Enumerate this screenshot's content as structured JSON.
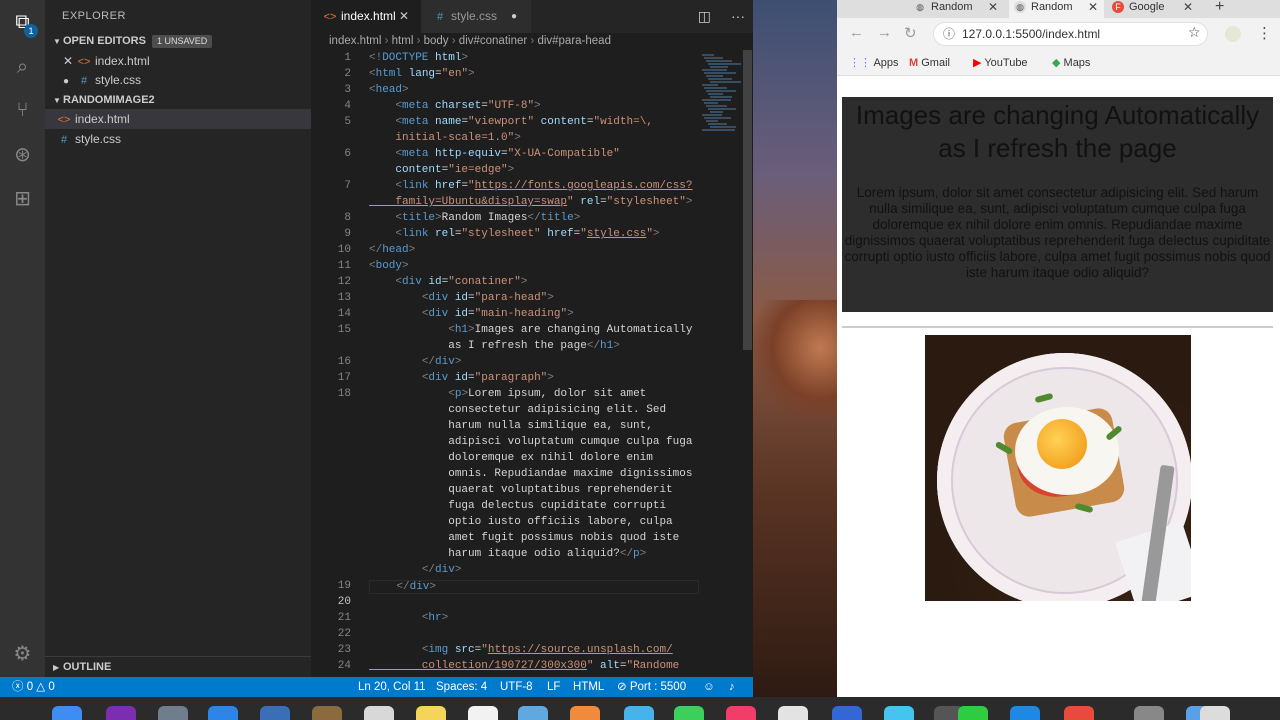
{
  "explorer": {
    "title": "EXPLORER",
    "open_editors_label": "OPEN EDITORS",
    "unsaved_badge": "1 UNSAVED",
    "open_editors": [
      {
        "name": "index.html",
        "type": "html"
      },
      {
        "name": "style.css",
        "type": "css"
      }
    ],
    "project_label": "RANDOMIMAGE2",
    "project_files": [
      {
        "name": "index.html",
        "type": "html"
      },
      {
        "name": "style.css",
        "type": "css"
      }
    ],
    "outline_label": "OUTLINE",
    "activity_badge": "1"
  },
  "tabs": [
    {
      "label": "index.html",
      "icon": "<>",
      "active": true
    },
    {
      "label": "style.css",
      "icon": "#",
      "active": false
    }
  ],
  "breadcrumb": [
    "index.html",
    "html",
    "body",
    "div#conatiner",
    "div#para-head"
  ],
  "line_numbers": [
    "1",
    "2",
    "3",
    "4",
    "5",
    "",
    "6",
    "",
    "7",
    "",
    "8",
    "9",
    "10",
    "11",
    "12",
    "13",
    "14",
    "15",
    "",
    "16",
    "17",
    "18",
    "",
    "",
    "",
    "",
    "",
    "",
    "",
    "",
    "",
    "",
    "",
    "19",
    "20",
    "21",
    "22",
    "23",
    "24",
    ""
  ],
  "code_lines": [
    [
      {
        "c": "tg",
        "t": "<!"
      },
      {
        "c": "tn",
        "t": "DOCTYPE"
      },
      {
        "c": "at",
        "t": " html"
      },
      {
        "c": "tg",
        "t": ">"
      }
    ],
    [
      {
        "c": "tg",
        "t": "<"
      },
      {
        "c": "tn",
        "t": "html"
      },
      {
        "c": "at",
        "t": " lang"
      },
      {
        "c": "tx",
        "t": "="
      },
      {
        "c": "sv",
        "t": "\"en\""
      },
      {
        "c": "tg",
        "t": ">"
      }
    ],
    [
      {
        "c": "tg",
        "t": "<"
      },
      {
        "c": "tn",
        "t": "head"
      },
      {
        "c": "tg",
        "t": ">"
      }
    ],
    [
      {
        "c": "tx",
        "t": "    "
      },
      {
        "c": "tg",
        "t": "<"
      },
      {
        "c": "tn",
        "t": "meta"
      },
      {
        "c": "at",
        "t": " charset"
      },
      {
        "c": "tx",
        "t": "="
      },
      {
        "c": "sv",
        "t": "\"UTF-8\""
      },
      {
        "c": "tg",
        "t": ">"
      }
    ],
    [
      {
        "c": "tx",
        "t": "    "
      },
      {
        "c": "tg",
        "t": "<"
      },
      {
        "c": "tn",
        "t": "meta"
      },
      {
        "c": "at",
        "t": " name"
      },
      {
        "c": "tx",
        "t": "="
      },
      {
        "c": "sv",
        "t": "\"viewport\""
      },
      {
        "c": "at",
        "t": " content"
      },
      {
        "c": "tx",
        "t": "="
      },
      {
        "c": "sv",
        "t": "\"width=\\,"
      }
    ],
    [
      {
        "c": "sv",
        "t": "    initial-scale=1.0\""
      },
      {
        "c": "tg",
        "t": ">"
      }
    ],
    [
      {
        "c": "tx",
        "t": "    "
      },
      {
        "c": "tg",
        "t": "<"
      },
      {
        "c": "tn",
        "t": "meta"
      },
      {
        "c": "at",
        "t": " http-equiv"
      },
      {
        "c": "tx",
        "t": "="
      },
      {
        "c": "sv",
        "t": "\"X-UA-Compatible\""
      }
    ],
    [
      {
        "c": "at",
        "t": "    content"
      },
      {
        "c": "tx",
        "t": "="
      },
      {
        "c": "sv",
        "t": "\"ie=edge\""
      },
      {
        "c": "tg",
        "t": ">"
      }
    ],
    [
      {
        "c": "tx",
        "t": "    "
      },
      {
        "c": "tg",
        "t": "<"
      },
      {
        "c": "tn",
        "t": "link"
      },
      {
        "c": "at",
        "t": " href"
      },
      {
        "c": "tx",
        "t": "="
      },
      {
        "c": "sv",
        "t": "\""
      },
      {
        "c": "sv u",
        "t": "https://fonts.googleapis.com/css?"
      }
    ],
    [
      {
        "c": "sv u",
        "t": "    family=Ubuntu&display=swap"
      },
      {
        "c": "sv",
        "t": "\""
      },
      {
        "c": "at",
        "t": " rel"
      },
      {
        "c": "tx",
        "t": "="
      },
      {
        "c": "sv",
        "t": "\"stylesheet\""
      },
      {
        "c": "tg",
        "t": ">"
      }
    ],
    [
      {
        "c": "tx",
        "t": "    "
      },
      {
        "c": "tg",
        "t": "<"
      },
      {
        "c": "tn",
        "t": "title"
      },
      {
        "c": "tg",
        "t": ">"
      },
      {
        "c": "tx",
        "t": "Random Images"
      },
      {
        "c": "tg",
        "t": "</"
      },
      {
        "c": "tn",
        "t": "title"
      },
      {
        "c": "tg",
        "t": ">"
      }
    ],
    [
      {
        "c": "tx",
        "t": "    "
      },
      {
        "c": "tg",
        "t": "<"
      },
      {
        "c": "tn",
        "t": "link"
      },
      {
        "c": "at",
        "t": " rel"
      },
      {
        "c": "tx",
        "t": "="
      },
      {
        "c": "sv",
        "t": "\"stylesheet\""
      },
      {
        "c": "at",
        "t": " href"
      },
      {
        "c": "tx",
        "t": "="
      },
      {
        "c": "sv",
        "t": "\""
      },
      {
        "c": "sv u",
        "t": "style.css"
      },
      {
        "c": "sv",
        "t": "\""
      },
      {
        "c": "tg",
        "t": ">"
      }
    ],
    [
      {
        "c": "tg",
        "t": "</"
      },
      {
        "c": "tn",
        "t": "head"
      },
      {
        "c": "tg",
        "t": ">"
      }
    ],
    [
      {
        "c": "tg",
        "t": "<"
      },
      {
        "c": "tn",
        "t": "body"
      },
      {
        "c": "tg",
        "t": ">"
      }
    ],
    [
      {
        "c": "tx",
        "t": "    "
      },
      {
        "c": "tg",
        "t": "<"
      },
      {
        "c": "tn",
        "t": "div"
      },
      {
        "c": "at",
        "t": " id"
      },
      {
        "c": "tx",
        "t": "="
      },
      {
        "c": "sv",
        "t": "\"conatiner\""
      },
      {
        "c": "tg",
        "t": ">"
      }
    ],
    [
      {
        "c": "tx",
        "t": "        "
      },
      {
        "c": "tg",
        "t": "<"
      },
      {
        "c": "tn",
        "t": "div"
      },
      {
        "c": "at",
        "t": " id"
      },
      {
        "c": "tx",
        "t": "="
      },
      {
        "c": "sv",
        "t": "\"para-head\""
      },
      {
        "c": "tg",
        "t": ">"
      }
    ],
    [
      {
        "c": "tx",
        "t": "        "
      },
      {
        "c": "tg",
        "t": "<"
      },
      {
        "c": "tn",
        "t": "div"
      },
      {
        "c": "at",
        "t": " id"
      },
      {
        "c": "tx",
        "t": "="
      },
      {
        "c": "sv",
        "t": "\"main-heading\""
      },
      {
        "c": "tg",
        "t": ">"
      }
    ],
    [
      {
        "c": "tx",
        "t": "            "
      },
      {
        "c": "tg",
        "t": "<"
      },
      {
        "c": "tn",
        "t": "h1"
      },
      {
        "c": "tg",
        "t": ">"
      },
      {
        "c": "tx",
        "t": "Images are changing Automatically"
      }
    ],
    [
      {
        "c": "tx",
        "t": "            as I refresh the page"
      },
      {
        "c": "tg",
        "t": "</"
      },
      {
        "c": "tn",
        "t": "h1"
      },
      {
        "c": "tg",
        "t": ">"
      }
    ],
    [
      {
        "c": "tx",
        "t": "        "
      },
      {
        "c": "tg",
        "t": "</"
      },
      {
        "c": "tn",
        "t": "div"
      },
      {
        "c": "tg",
        "t": ">"
      }
    ],
    [
      {
        "c": "tx",
        "t": "        "
      },
      {
        "c": "tg",
        "t": "<"
      },
      {
        "c": "tn",
        "t": "div"
      },
      {
        "c": "at",
        "t": " id"
      },
      {
        "c": "tx",
        "t": "="
      },
      {
        "c": "sv",
        "t": "\"paragraph\""
      },
      {
        "c": "tg",
        "t": ">"
      }
    ],
    [
      {
        "c": "tx",
        "t": "            "
      },
      {
        "c": "tg",
        "t": "<"
      },
      {
        "c": "tn",
        "t": "p"
      },
      {
        "c": "tg",
        "t": ">"
      },
      {
        "c": "tx",
        "t": "Lorem ipsum, dolor sit amet"
      }
    ],
    [
      {
        "c": "tx",
        "t": "            consectetur adipisicing elit. Sed"
      }
    ],
    [
      {
        "c": "tx",
        "t": "            harum nulla similique ea, sunt,"
      }
    ],
    [
      {
        "c": "tx",
        "t": "            adipisci voluptatum cumque culpa fuga"
      }
    ],
    [
      {
        "c": "tx",
        "t": "            doloremque ex nihil dolore enim"
      }
    ],
    [
      {
        "c": "tx",
        "t": "            omnis. Repudiandae maxime dignissimos"
      }
    ],
    [
      {
        "c": "tx",
        "t": "            quaerat voluptatibus reprehenderit"
      }
    ],
    [
      {
        "c": "tx",
        "t": "            fuga delectus cupiditate corrupti"
      }
    ],
    [
      {
        "c": "tx",
        "t": "            optio iusto officiis labore, culpa"
      }
    ],
    [
      {
        "c": "tx",
        "t": "            amet fugit possimus nobis quod iste"
      }
    ],
    [
      {
        "c": "tx",
        "t": "            harum itaque odio aliquid?"
      },
      {
        "c": "tg",
        "t": "</"
      },
      {
        "c": "tn",
        "t": "p"
      },
      {
        "c": "tg",
        "t": ">"
      }
    ],
    [
      {
        "c": "tx",
        "t": "        "
      },
      {
        "c": "tg",
        "t": "</"
      },
      {
        "c": "tn",
        "t": "div"
      },
      {
        "c": "tg",
        "t": ">"
      }
    ],
    [
      {
        "c": "tx",
        "t": "    "
      },
      {
        "c": "tg",
        "t": "</"
      },
      {
        "c": "tn",
        "t": "div"
      },
      {
        "c": "tg",
        "t": ">"
      }
    ],
    [],
    [
      {
        "c": "tx",
        "t": "        "
      },
      {
        "c": "tg",
        "t": "<"
      },
      {
        "c": "tn",
        "t": "hr"
      },
      {
        "c": "tg",
        "t": ">"
      }
    ],
    [],
    [
      {
        "c": "tx",
        "t": "        "
      },
      {
        "c": "tg",
        "t": "<"
      },
      {
        "c": "tn",
        "t": "img"
      },
      {
        "c": "at",
        "t": " src"
      },
      {
        "c": "tx",
        "t": "="
      },
      {
        "c": "sv",
        "t": "\""
      },
      {
        "c": "sv u",
        "t": "https://source.unsplash.com/"
      }
    ],
    [
      {
        "c": "sv u",
        "t": "        collection/190727/300x300"
      },
      {
        "c": "sv",
        "t": "\""
      },
      {
        "c": "at",
        "t": " alt"
      },
      {
        "c": "tx",
        "t": "="
      },
      {
        "c": "sv",
        "t": "\"Randome"
      }
    ]
  ],
  "status": {
    "errors": "0",
    "warnings": "0",
    "position": "Ln 20, Col 11",
    "spaces": "Spaces: 4",
    "encoding": "UTF-8",
    "eol": "LF",
    "language": "HTML",
    "port": "Port : 5500"
  },
  "browser": {
    "tabs": [
      {
        "label": "Random",
        "favicon": "globe-icon",
        "active": false
      },
      {
        "label": "Random",
        "favicon": "globe-icon",
        "active": true
      },
      {
        "label": "Google",
        "favicon": "F",
        "active": false
      }
    ],
    "url": "127.0.0.1:5500/index.html",
    "bookmarks": [
      "Apps",
      "Gmail",
      "YouTube",
      "Maps"
    ],
    "heading": "Images are changing Automatically as I refresh the page",
    "paragraph": "Lorem ipsum, dolor sit amet consectetur adipisicing elit. Sed harum nulla similique ea, sunt, adipisci voluptatum cumque culpa fuga doloremque ex nihil dolore enim omnis. Repudiandae maxime dignissimos quaerat voluptatibus reprehenderit fuga delectus cupiditate corrupti optio iusto officiis labore, culpa amet fugit possimus nobis quod iste harum itaque odio aliquid?"
  },
  "colors": {
    "status_bar": "#007acc",
    "para_head_bg": "#2d2d2d"
  }
}
